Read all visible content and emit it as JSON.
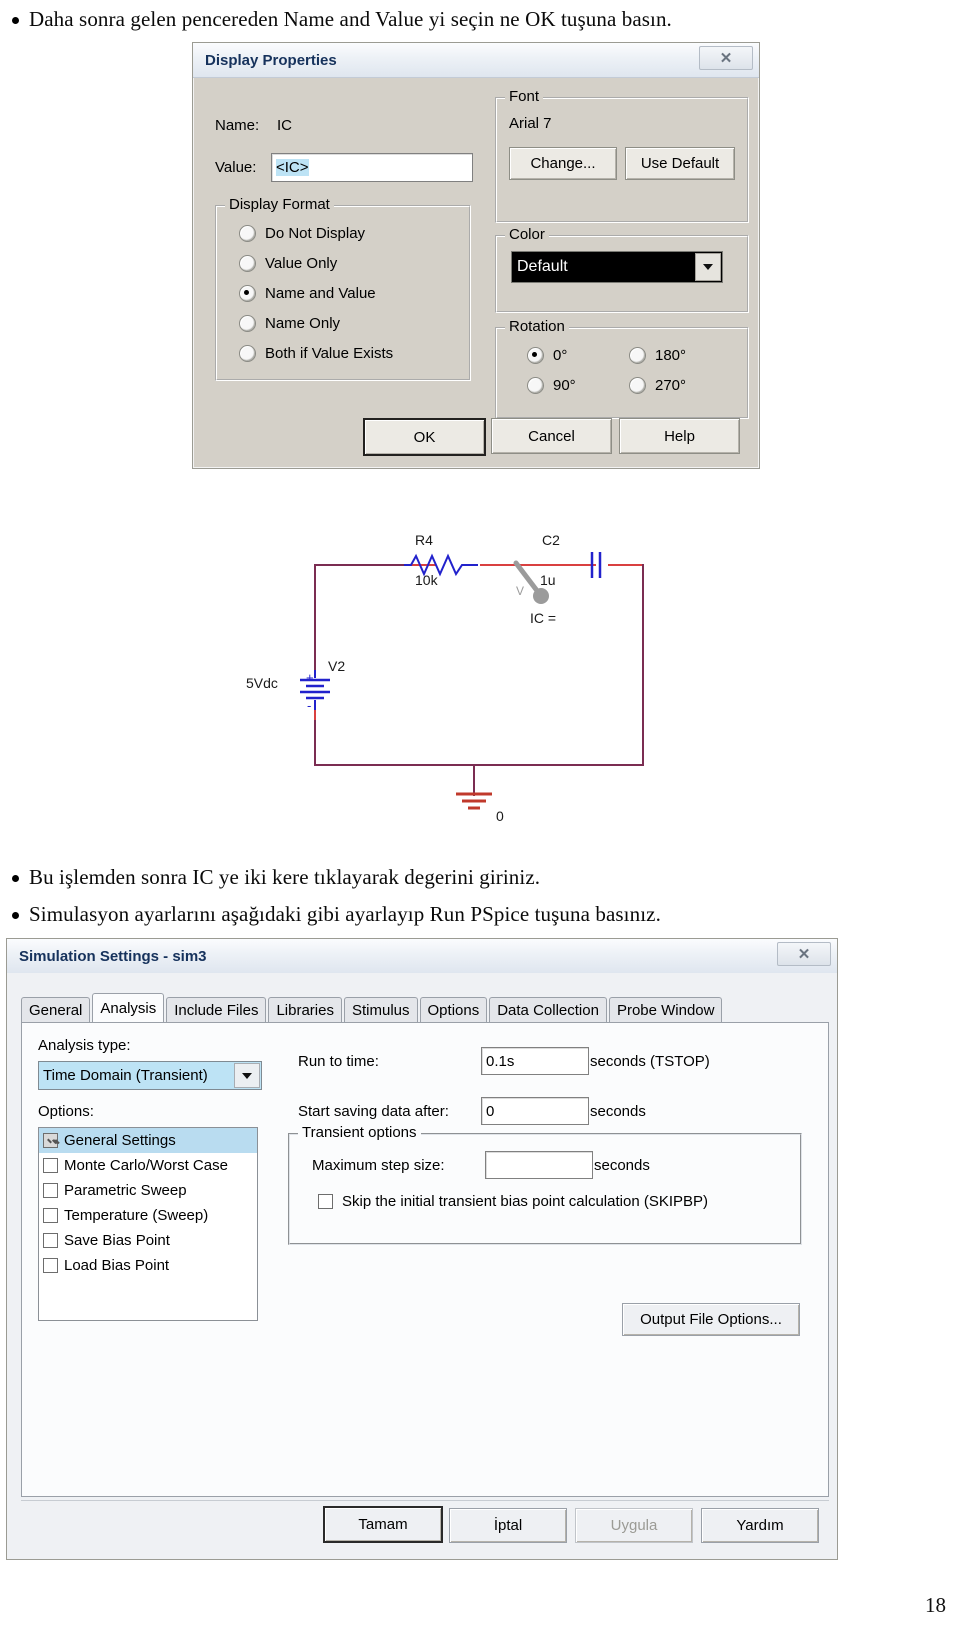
{
  "document": {
    "bullets": [
      "Daha sonra gelen pencereden Name and Value yi seçin ne OK tuşuna basın.",
      "Bu işlemden sonra IC ye iki kere tıklayarak degerini giriniz.",
      "Simulasyon ayarlarını aşağıdaki gibi ayarlayıp Run PSpice tuşuna basınız."
    ],
    "page_number": "18"
  },
  "display_properties": {
    "title": "Display Properties",
    "close_glyph": "✕",
    "name_label": "Name:",
    "name_value": "IC",
    "value_label": "Value:",
    "value_text": "<IC>",
    "display_format": {
      "group_label": "Display Format",
      "options": [
        "Do Not Display",
        "Value Only",
        "Name and Value",
        "Name Only",
        "Both if Value Exists"
      ],
      "selected": "Name and Value"
    },
    "font": {
      "group_label": "Font",
      "current": "Arial 7",
      "change_button": "Change...",
      "use_default_button": "Use Default"
    },
    "color": {
      "group_label": "Color",
      "value": "Default",
      "swatch_hex": "#000000"
    },
    "rotation": {
      "group_label": "Rotation",
      "options": [
        "0°",
        "90°",
        "180°",
        "270°"
      ],
      "selected": "0°"
    },
    "buttons": {
      "ok": "OK",
      "cancel": "Cancel",
      "help": "Help"
    }
  },
  "schematic": {
    "resistor": {
      "name": "R4",
      "value": "10k"
    },
    "capacitor": {
      "name": "C2",
      "value": "1u",
      "ic_label": "IC ="
    },
    "source": {
      "name": "V2",
      "value": "5Vdc",
      "plus": "+",
      "minus": "-"
    },
    "ground": {
      "label": "0"
    },
    "cursor_label": "V"
  },
  "simulation_settings": {
    "title": "Simulation Settings - sim3",
    "close_glyph": "✕",
    "tabs": [
      "General",
      "Analysis",
      "Include Files",
      "Libraries",
      "Stimulus",
      "Options",
      "Data Collection",
      "Probe Window"
    ],
    "active_tab": "Analysis",
    "analysis_type_label": "Analysis type:",
    "analysis_type_value": "Time Domain (Transient)",
    "options_label": "Options:",
    "options": [
      {
        "label": "General Settings",
        "checked": true,
        "selected": true
      },
      {
        "label": "Monte Carlo/Worst Case",
        "checked": false,
        "selected": false
      },
      {
        "label": "Parametric Sweep",
        "checked": false,
        "selected": false
      },
      {
        "label": "Temperature (Sweep)",
        "checked": false,
        "selected": false
      },
      {
        "label": "Save Bias Point",
        "checked": false,
        "selected": false
      },
      {
        "label": "Load Bias Point",
        "checked": false,
        "selected": false
      }
    ],
    "run_to_time_label": "Run to time:",
    "run_to_time_value": "0.1s",
    "run_to_time_units": "seconds  (TSTOP)",
    "start_saving_label": "Start saving data after:",
    "start_saving_value": "0",
    "start_saving_units": "seconds",
    "transient_group_label": "Transient options",
    "max_step_label": "Maximum step size:",
    "max_step_value": "",
    "max_step_units": "seconds",
    "skipbp_label": "Skip the initial transient bias point calculation  (SKIPBP)",
    "skipbp_checked": false,
    "output_file_options_button": "Output File Options...",
    "buttons": {
      "ok": "Tamam",
      "cancel": "İptal",
      "apply": "Uygula",
      "help": "Yardım"
    }
  }
}
